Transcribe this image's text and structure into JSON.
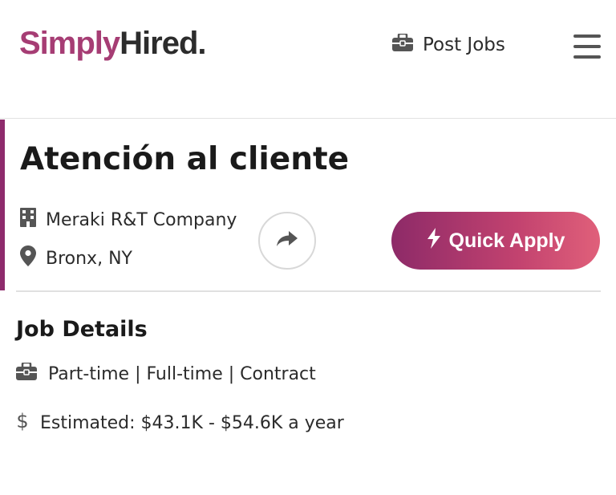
{
  "header": {
    "logo_part1": "Simply",
    "logo_part2": "Hired.",
    "post_jobs_label": "Post Jobs",
    "post_jobs_icon": "briefcase-icon",
    "menu_icon": "hamburger-menu-icon"
  },
  "job": {
    "title": "Atención al cliente",
    "company": "Meraki R&T Company",
    "company_icon": "building-icon",
    "location": "Bronx, NY",
    "location_icon": "map-pin-icon",
    "share_icon": "share-arrow-icon",
    "apply_label": "Quick Apply",
    "apply_icon": "lightning-bolt-icon"
  },
  "details": {
    "heading": "Job Details",
    "job_types": "Part-time | Full-time | Contract",
    "job_types_icon": "briefcase-icon",
    "salary": "Estimated: $43.1K - $54.6K a year",
    "salary_icon": "dollar-icon"
  },
  "colors": {
    "brand_purple": "#8d2a68",
    "brand_pink": "#e0607a",
    "logo_simply": "#a63d74",
    "logo_hired": "#2c2c2c"
  }
}
